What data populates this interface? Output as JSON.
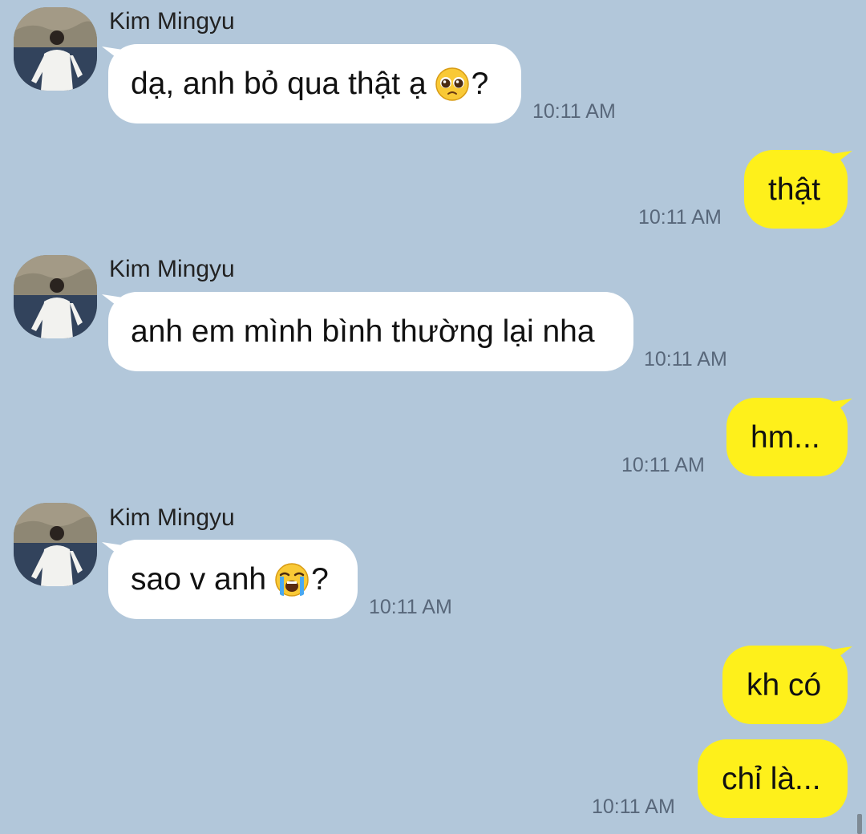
{
  "contact": {
    "name": "Kim Mingyu"
  },
  "messages": [
    {
      "direction": "incoming",
      "sender": "Kim Mingyu",
      "text": "dạ, anh bỏ qua thật ạ",
      "emoji": "pleading-face-icon",
      "suffix": "?",
      "time": "10:11 AM"
    },
    {
      "direction": "outgoing",
      "text": "thật",
      "time": "10:11 AM"
    },
    {
      "direction": "incoming",
      "sender": "Kim Mingyu",
      "text": "anh em mình bình thường lại nha",
      "time": "10:11 AM"
    },
    {
      "direction": "outgoing",
      "text": "hm...",
      "time": "10:11 AM"
    },
    {
      "direction": "incoming",
      "sender": "Kim Mingyu",
      "text": "sao v anh",
      "emoji": "loudly-crying-face-icon",
      "suffix": "?",
      "time": "10:11 AM"
    },
    {
      "direction": "outgoing",
      "text": "kh có"
    },
    {
      "direction": "outgoing",
      "text": "chỉ là...",
      "time": "10:11 AM"
    }
  ],
  "colors": {
    "background": "#b2c7da",
    "incoming_bubble": "#ffffff",
    "outgoing_bubble": "#fef01b",
    "timestamp": "#58677a"
  }
}
